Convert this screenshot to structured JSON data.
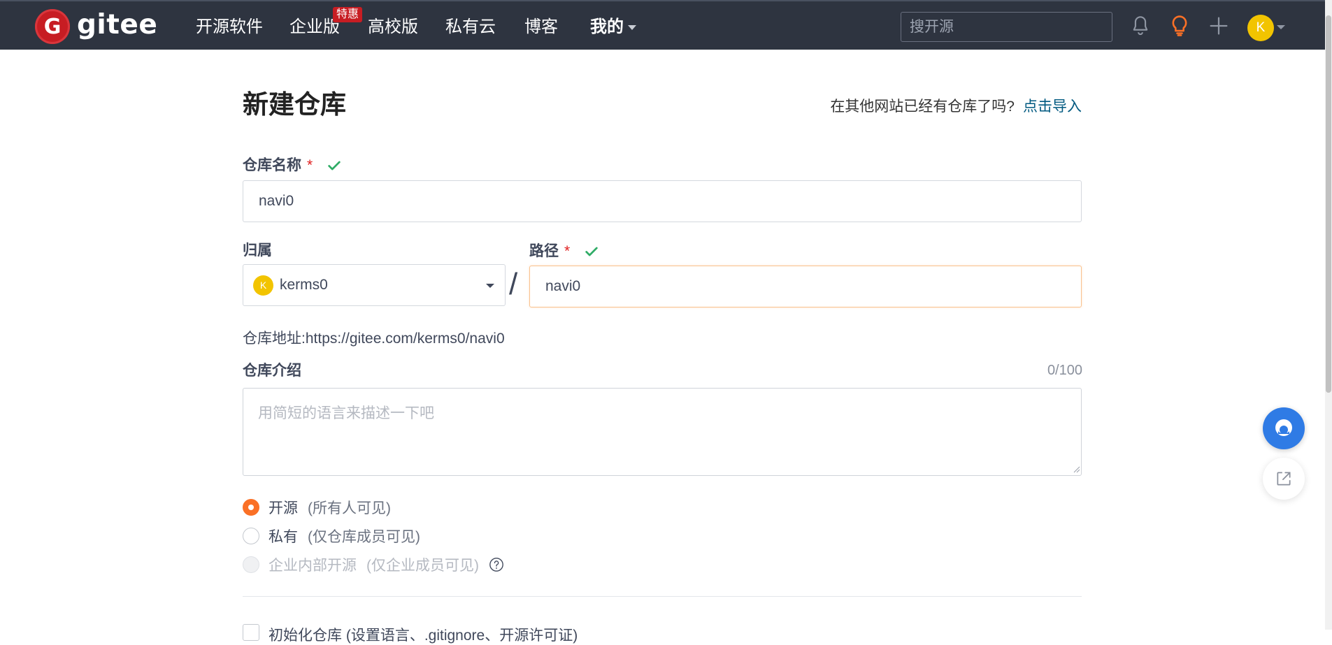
{
  "nav": {
    "logo_text": "gitee",
    "logo_letter": "G",
    "items": [
      {
        "label": "开源软件"
      },
      {
        "label": "企业版"
      },
      {
        "label": "高校版"
      },
      {
        "label": "私有云"
      },
      {
        "label": "博客"
      },
      {
        "label": "我的"
      }
    ],
    "badge": "特惠",
    "search_placeholder": "搜开源",
    "avatar_letter": "K"
  },
  "form": {
    "title": "新建仓库",
    "import_hint": "在其他网站已经有仓库了吗?",
    "import_link": "点击导入",
    "repo_name_label": "仓库名称",
    "repo_name_value": "navi0",
    "required_mark": "*",
    "owner_label": "归属",
    "owner_avatar_letter": "K",
    "owner_value": "kerms0",
    "separator": "/",
    "path_label": "路径",
    "path_value": "navi0",
    "address_label": "仓库地址:",
    "address_value": "https://gitee.com/kerms0/navi0",
    "intro_label": "仓库介绍",
    "intro_counter": "0/100",
    "intro_placeholder": "用简短的语言来描述一下吧",
    "visibility": [
      {
        "label": "开源",
        "note": "(所有人可见)",
        "state": "checked"
      },
      {
        "label": "私有",
        "note": "(仅仓库成员可见)",
        "state": "unchecked"
      },
      {
        "label": "企业内部开源",
        "note": "(仅企业成员可见)",
        "state": "disabled"
      }
    ],
    "bottom_option_partial": "初始化仓库 (设置语言、.gitignore、开源许可证)"
  },
  "colors": {
    "nav_bg": "#2e3440",
    "brand_red": "#c71d23",
    "accent_orange": "#fa7026",
    "link_blue": "#005980",
    "success_green": "#2fac66"
  }
}
